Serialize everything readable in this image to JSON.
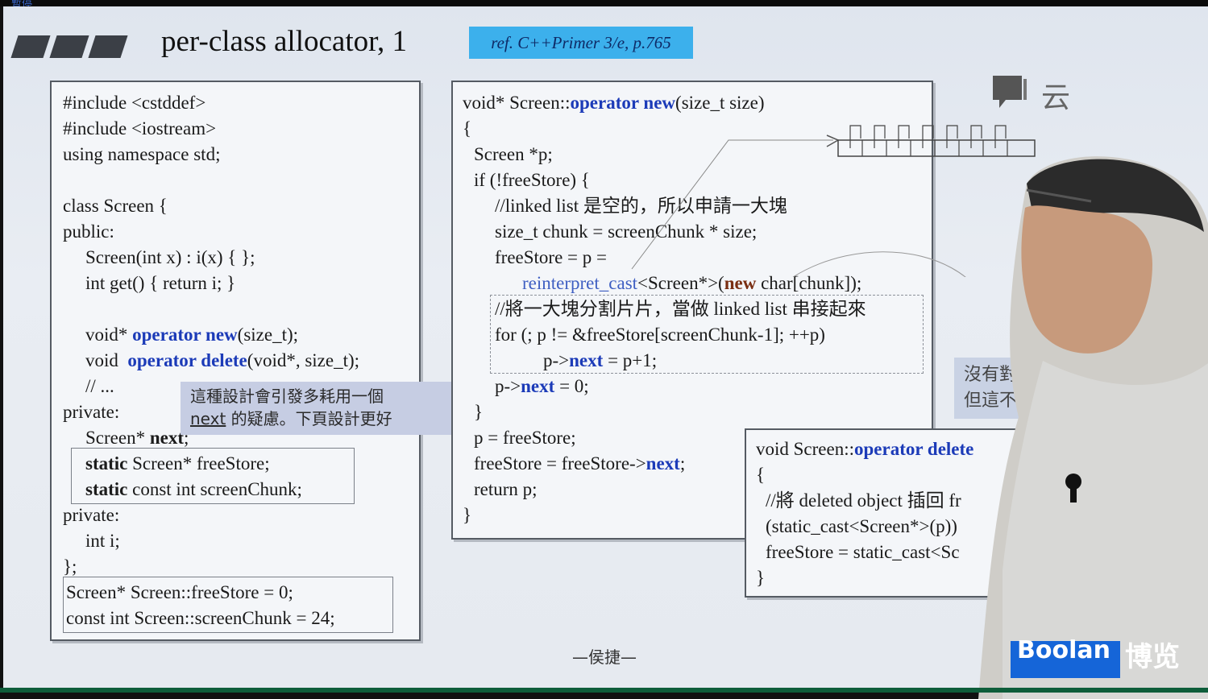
{
  "player": {
    "pause_label": "暫停"
  },
  "slide": {
    "title": "per-class allocator, 1",
    "reference": "ref. C++Primer 3/e, p.765",
    "footer": "—侯捷—",
    "brand": {
      "logo_text": "Boolan",
      "logo_cn": "博览",
      "watermark_partial": "云"
    },
    "left_code": {
      "l1": "#include <cstddef>",
      "l2": "#include <iostream>",
      "l3": "using namespace std;",
      "l4": "class Screen {",
      "l5": "public:",
      "l6": "Screen(int x) : i(x) { };",
      "l7": "int get() { return i; }",
      "l8a": "void* ",
      "l8b": "operator new",
      "l8c": "(size_t);",
      "l9a": "void  ",
      "l9b": "operator delete",
      "l9c": "(void*, size_t);",
      "l10": "// ...",
      "l11": "private:",
      "l12a": "Screen* ",
      "l12b": "next",
      "l12c": ";",
      "l13a": "static",
      "l13b": " Screen* freeStore;",
      "l14a": "static",
      "l14b": " const int screenChunk;",
      "l15": "private:",
      "l16": "int i;",
      "l17": "};",
      "l18": "Screen* Screen::freeStore = 0;",
      "l19": "const int Screen::screenChunk = 24;"
    },
    "note_popup": {
      "line1": "這種設計會引發多耗用一個",
      "line2a": "next",
      "line2b": " 的疑慮。下頁設計更好"
    },
    "middle_code": {
      "m1a": "void* Screen::",
      "m1b": "operator new",
      "m1c": "(size_t size)",
      "m2": "{",
      "m3": "Screen *p;",
      "m4": "if (!freeStore) {",
      "m5": "//linked list 是空的，所以申請一大塊",
      "m6": "size_t chunk = screenChunk * size;",
      "m7": "freeStore = p =",
      "m8a": "reinterpret_cast",
      "m8b": "<Screen*>(",
      "m8c": "new",
      "m8d": " char[chunk]);",
      "m9": "//將一大塊分割片片，當做 linked list 串接起來",
      "m10": "for (; p != &freeStore[screenChunk-1]; ++p)",
      "m11a": "p->",
      "m11b": "next",
      "m11c": " = p+1;",
      "m12a": "p->",
      "m12b": "next",
      "m12c": " = 0;",
      "m13": "}",
      "m14": "p = freeStore;",
      "m15a": "freeStore = freeStore->",
      "m15b": "next",
      "m15c": ";",
      "m16": "return p;",
      "m17": "}"
    },
    "right_code": {
      "r1a": "void Screen::",
      "r1b": "operator delete",
      "r2": "{",
      "r3": "//將 deleted object 插回 fr",
      "r4": "(static_cast<Screen*>(p))",
      "r5": "freeStore = static_cast<Sc",
      "r6": "}"
    },
    "side_note": {
      "line1": "沒有對應的",
      "line2": "但這不算"
    }
  }
}
